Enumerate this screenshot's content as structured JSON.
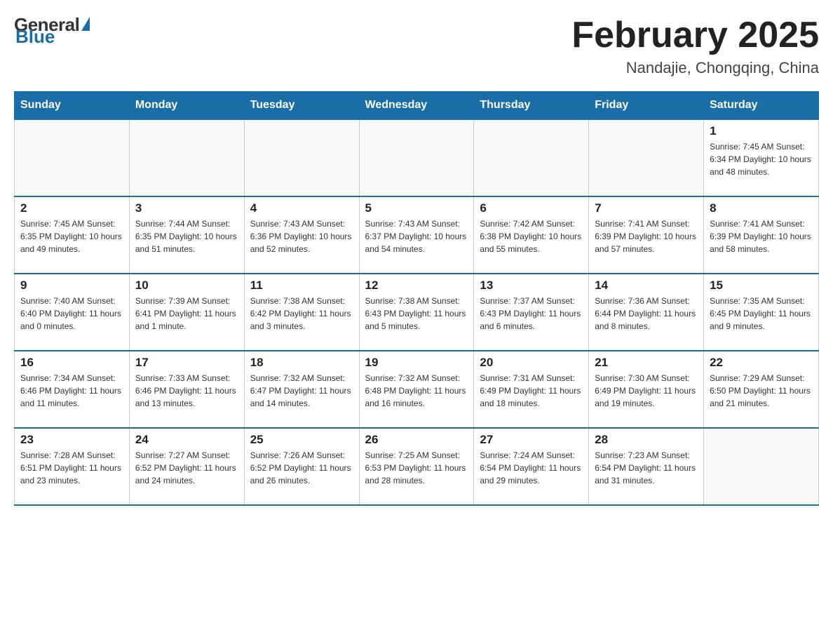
{
  "header": {
    "logo": {
      "general_text": "General",
      "blue_text": "Blue"
    },
    "title": "February 2025",
    "location": "Nandajie, Chongqing, China"
  },
  "days_of_week": [
    "Sunday",
    "Monday",
    "Tuesday",
    "Wednesday",
    "Thursday",
    "Friday",
    "Saturday"
  ],
  "weeks": [
    {
      "days": [
        {
          "number": "",
          "info": ""
        },
        {
          "number": "",
          "info": ""
        },
        {
          "number": "",
          "info": ""
        },
        {
          "number": "",
          "info": ""
        },
        {
          "number": "",
          "info": ""
        },
        {
          "number": "",
          "info": ""
        },
        {
          "number": "1",
          "info": "Sunrise: 7:45 AM\nSunset: 6:34 PM\nDaylight: 10 hours\nand 48 minutes."
        }
      ]
    },
    {
      "days": [
        {
          "number": "2",
          "info": "Sunrise: 7:45 AM\nSunset: 6:35 PM\nDaylight: 10 hours\nand 49 minutes."
        },
        {
          "number": "3",
          "info": "Sunrise: 7:44 AM\nSunset: 6:35 PM\nDaylight: 10 hours\nand 51 minutes."
        },
        {
          "number": "4",
          "info": "Sunrise: 7:43 AM\nSunset: 6:36 PM\nDaylight: 10 hours\nand 52 minutes."
        },
        {
          "number": "5",
          "info": "Sunrise: 7:43 AM\nSunset: 6:37 PM\nDaylight: 10 hours\nand 54 minutes."
        },
        {
          "number": "6",
          "info": "Sunrise: 7:42 AM\nSunset: 6:38 PM\nDaylight: 10 hours\nand 55 minutes."
        },
        {
          "number": "7",
          "info": "Sunrise: 7:41 AM\nSunset: 6:39 PM\nDaylight: 10 hours\nand 57 minutes."
        },
        {
          "number": "8",
          "info": "Sunrise: 7:41 AM\nSunset: 6:39 PM\nDaylight: 10 hours\nand 58 minutes."
        }
      ]
    },
    {
      "days": [
        {
          "number": "9",
          "info": "Sunrise: 7:40 AM\nSunset: 6:40 PM\nDaylight: 11 hours\nand 0 minutes."
        },
        {
          "number": "10",
          "info": "Sunrise: 7:39 AM\nSunset: 6:41 PM\nDaylight: 11 hours\nand 1 minute."
        },
        {
          "number": "11",
          "info": "Sunrise: 7:38 AM\nSunset: 6:42 PM\nDaylight: 11 hours\nand 3 minutes."
        },
        {
          "number": "12",
          "info": "Sunrise: 7:38 AM\nSunset: 6:43 PM\nDaylight: 11 hours\nand 5 minutes."
        },
        {
          "number": "13",
          "info": "Sunrise: 7:37 AM\nSunset: 6:43 PM\nDaylight: 11 hours\nand 6 minutes."
        },
        {
          "number": "14",
          "info": "Sunrise: 7:36 AM\nSunset: 6:44 PM\nDaylight: 11 hours\nand 8 minutes."
        },
        {
          "number": "15",
          "info": "Sunrise: 7:35 AM\nSunset: 6:45 PM\nDaylight: 11 hours\nand 9 minutes."
        }
      ]
    },
    {
      "days": [
        {
          "number": "16",
          "info": "Sunrise: 7:34 AM\nSunset: 6:46 PM\nDaylight: 11 hours\nand 11 minutes."
        },
        {
          "number": "17",
          "info": "Sunrise: 7:33 AM\nSunset: 6:46 PM\nDaylight: 11 hours\nand 13 minutes."
        },
        {
          "number": "18",
          "info": "Sunrise: 7:32 AM\nSunset: 6:47 PM\nDaylight: 11 hours\nand 14 minutes."
        },
        {
          "number": "19",
          "info": "Sunrise: 7:32 AM\nSunset: 6:48 PM\nDaylight: 11 hours\nand 16 minutes."
        },
        {
          "number": "20",
          "info": "Sunrise: 7:31 AM\nSunset: 6:49 PM\nDaylight: 11 hours\nand 18 minutes."
        },
        {
          "number": "21",
          "info": "Sunrise: 7:30 AM\nSunset: 6:49 PM\nDaylight: 11 hours\nand 19 minutes."
        },
        {
          "number": "22",
          "info": "Sunrise: 7:29 AM\nSunset: 6:50 PM\nDaylight: 11 hours\nand 21 minutes."
        }
      ]
    },
    {
      "days": [
        {
          "number": "23",
          "info": "Sunrise: 7:28 AM\nSunset: 6:51 PM\nDaylight: 11 hours\nand 23 minutes."
        },
        {
          "number": "24",
          "info": "Sunrise: 7:27 AM\nSunset: 6:52 PM\nDaylight: 11 hours\nand 24 minutes."
        },
        {
          "number": "25",
          "info": "Sunrise: 7:26 AM\nSunset: 6:52 PM\nDaylight: 11 hours\nand 26 minutes."
        },
        {
          "number": "26",
          "info": "Sunrise: 7:25 AM\nSunset: 6:53 PM\nDaylight: 11 hours\nand 28 minutes."
        },
        {
          "number": "27",
          "info": "Sunrise: 7:24 AM\nSunset: 6:54 PM\nDaylight: 11 hours\nand 29 minutes."
        },
        {
          "number": "28",
          "info": "Sunrise: 7:23 AM\nSunset: 6:54 PM\nDaylight: 11 hours\nand 31 minutes."
        },
        {
          "number": "",
          "info": ""
        }
      ]
    }
  ]
}
